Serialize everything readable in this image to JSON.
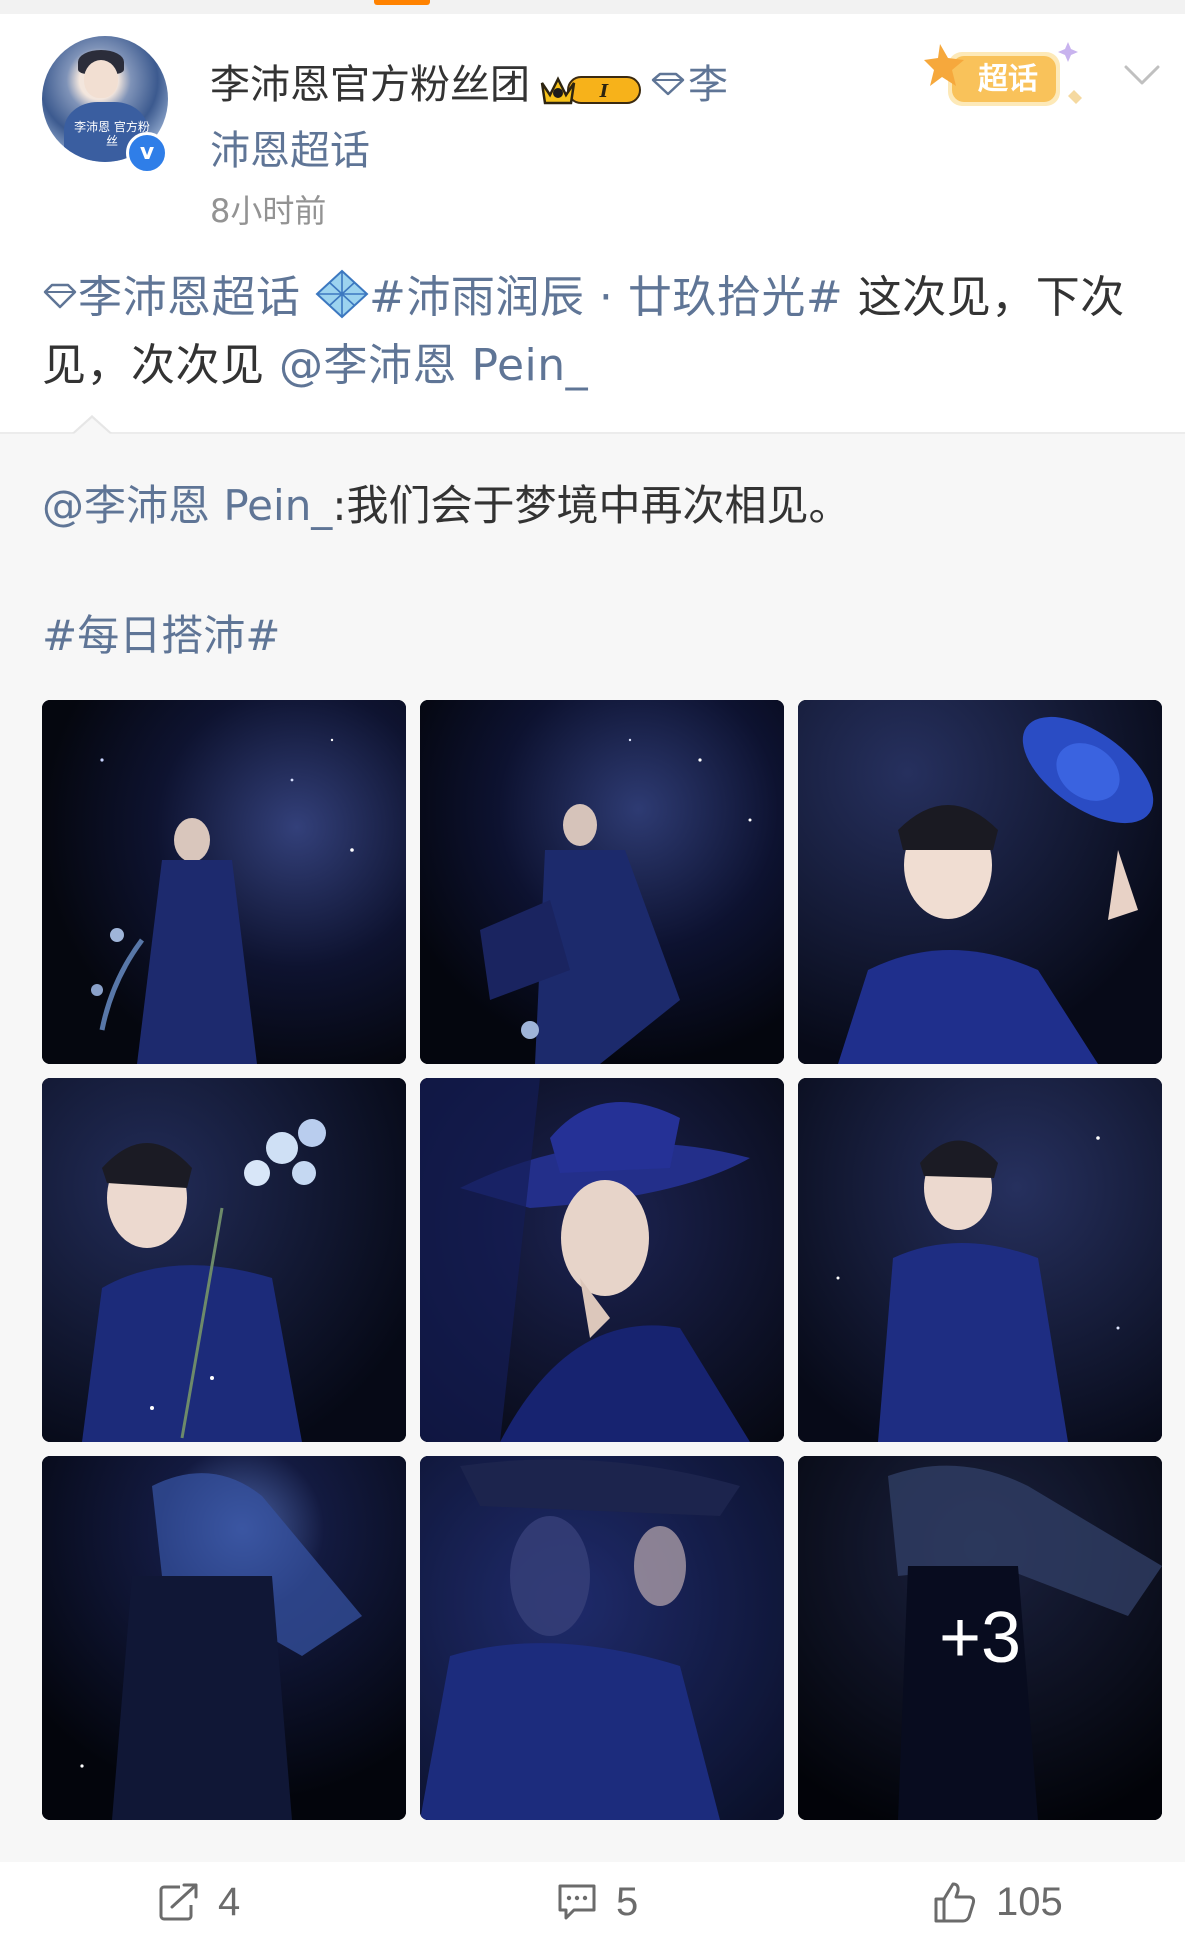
{
  "post": {
    "author": "李沛恩官方粉丝团",
    "level_badge": "I",
    "supertopic_line1": "李",
    "supertopic_line2": "沛恩超话",
    "timestamp": "8小时前",
    "super_badge_label": "超话",
    "avatar_caption": "李沛恩 官方粉丝",
    "text": {
      "supertopic": "李沛恩超话",
      "hashtag": "#沛雨润辰 · 廿玖拾光#",
      "body": " 这次见，下次见，次次见 ",
      "mention": "@李沛恩 Pein_"
    }
  },
  "repost": {
    "mention": "@李沛恩 Pein_",
    "text": ":我们会于梦境中再次相见。",
    "hashtag": "#每日搭沛#",
    "images_more": "+3"
  },
  "actions": {
    "repost_count": "4",
    "comment_count": "5",
    "like_count": "105"
  },
  "colors": {
    "link": "#5f7596",
    "accent_orange": "#ff8200",
    "verified_blue": "#2f7ee8"
  }
}
